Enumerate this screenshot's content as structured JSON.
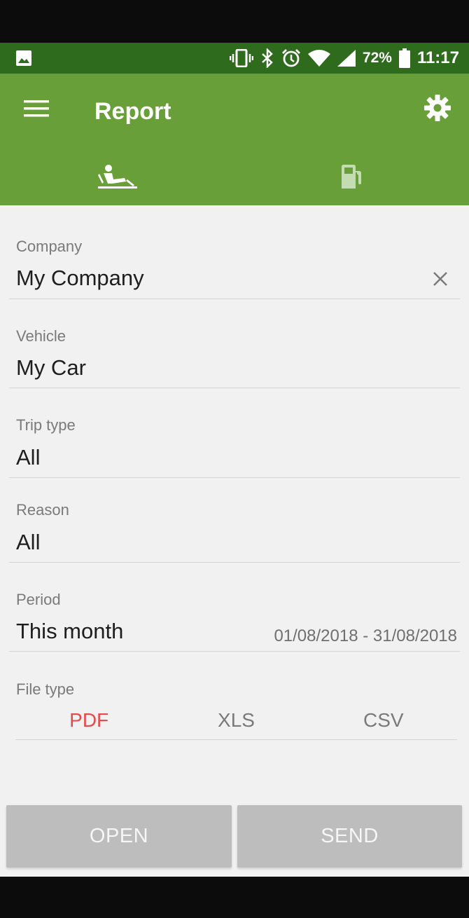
{
  "status_bar": {
    "left_icon": "image-icon",
    "icons": [
      "vibrate-icon",
      "bluetooth-icon",
      "alarm-icon",
      "wifi-icon",
      "signal-icon"
    ],
    "battery": "72%",
    "time": "11:17"
  },
  "app_bar": {
    "title": "Report",
    "menu_icon": "menu-icon",
    "settings_icon": "gear-icon",
    "tabs": [
      {
        "icon": "driver-icon",
        "active": true
      },
      {
        "icon": "fuel-pump-icon",
        "active": false
      }
    ],
    "color": "#689f38",
    "status_color": "#2e6b1c"
  },
  "form": {
    "company": {
      "label": "Company",
      "value": "My Company"
    },
    "vehicle": {
      "label": "Vehicle",
      "value": "My Car"
    },
    "trip_type": {
      "label": "Trip type",
      "value": "All"
    },
    "reason": {
      "label": "Reason",
      "value": "All"
    },
    "period": {
      "label": "Period",
      "value": "This month",
      "range": "01/08/2018 - 31/08/2018"
    },
    "file_type": {
      "label": "File type",
      "options": [
        "PDF",
        "XLS",
        "CSV"
      ],
      "selected": "PDF",
      "accent": "#e84a4a"
    }
  },
  "actions": {
    "open_label": "OPEN",
    "send_label": "SEND"
  }
}
